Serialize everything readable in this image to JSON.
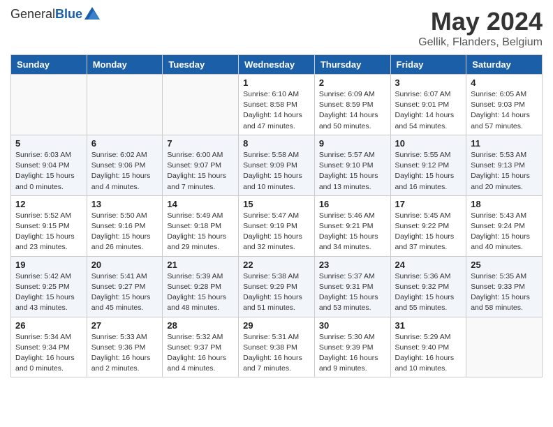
{
  "header": {
    "logo_general": "General",
    "logo_blue": "Blue",
    "title": "May 2024",
    "subtitle": "Gellik, Flanders, Belgium"
  },
  "weekdays": [
    "Sunday",
    "Monday",
    "Tuesday",
    "Wednesday",
    "Thursday",
    "Friday",
    "Saturday"
  ],
  "weeks": [
    [
      {
        "day": "",
        "info": ""
      },
      {
        "day": "",
        "info": ""
      },
      {
        "day": "",
        "info": ""
      },
      {
        "day": "1",
        "info": "Sunrise: 6:10 AM\nSunset: 8:58 PM\nDaylight: 14 hours\nand 47 minutes."
      },
      {
        "day": "2",
        "info": "Sunrise: 6:09 AM\nSunset: 8:59 PM\nDaylight: 14 hours\nand 50 minutes."
      },
      {
        "day": "3",
        "info": "Sunrise: 6:07 AM\nSunset: 9:01 PM\nDaylight: 14 hours\nand 54 minutes."
      },
      {
        "day": "4",
        "info": "Sunrise: 6:05 AM\nSunset: 9:03 PM\nDaylight: 14 hours\nand 57 minutes."
      }
    ],
    [
      {
        "day": "5",
        "info": "Sunrise: 6:03 AM\nSunset: 9:04 PM\nDaylight: 15 hours\nand 0 minutes."
      },
      {
        "day": "6",
        "info": "Sunrise: 6:02 AM\nSunset: 9:06 PM\nDaylight: 15 hours\nand 4 minutes."
      },
      {
        "day": "7",
        "info": "Sunrise: 6:00 AM\nSunset: 9:07 PM\nDaylight: 15 hours\nand 7 minutes."
      },
      {
        "day": "8",
        "info": "Sunrise: 5:58 AM\nSunset: 9:09 PM\nDaylight: 15 hours\nand 10 minutes."
      },
      {
        "day": "9",
        "info": "Sunrise: 5:57 AM\nSunset: 9:10 PM\nDaylight: 15 hours\nand 13 minutes."
      },
      {
        "day": "10",
        "info": "Sunrise: 5:55 AM\nSunset: 9:12 PM\nDaylight: 15 hours\nand 16 minutes."
      },
      {
        "day": "11",
        "info": "Sunrise: 5:53 AM\nSunset: 9:13 PM\nDaylight: 15 hours\nand 20 minutes."
      }
    ],
    [
      {
        "day": "12",
        "info": "Sunrise: 5:52 AM\nSunset: 9:15 PM\nDaylight: 15 hours\nand 23 minutes."
      },
      {
        "day": "13",
        "info": "Sunrise: 5:50 AM\nSunset: 9:16 PM\nDaylight: 15 hours\nand 26 minutes."
      },
      {
        "day": "14",
        "info": "Sunrise: 5:49 AM\nSunset: 9:18 PM\nDaylight: 15 hours\nand 29 minutes."
      },
      {
        "day": "15",
        "info": "Sunrise: 5:47 AM\nSunset: 9:19 PM\nDaylight: 15 hours\nand 32 minutes."
      },
      {
        "day": "16",
        "info": "Sunrise: 5:46 AM\nSunset: 9:21 PM\nDaylight: 15 hours\nand 34 minutes."
      },
      {
        "day": "17",
        "info": "Sunrise: 5:45 AM\nSunset: 9:22 PM\nDaylight: 15 hours\nand 37 minutes."
      },
      {
        "day": "18",
        "info": "Sunrise: 5:43 AM\nSunset: 9:24 PM\nDaylight: 15 hours\nand 40 minutes."
      }
    ],
    [
      {
        "day": "19",
        "info": "Sunrise: 5:42 AM\nSunset: 9:25 PM\nDaylight: 15 hours\nand 43 minutes."
      },
      {
        "day": "20",
        "info": "Sunrise: 5:41 AM\nSunset: 9:27 PM\nDaylight: 15 hours\nand 45 minutes."
      },
      {
        "day": "21",
        "info": "Sunrise: 5:39 AM\nSunset: 9:28 PM\nDaylight: 15 hours\nand 48 minutes."
      },
      {
        "day": "22",
        "info": "Sunrise: 5:38 AM\nSunset: 9:29 PM\nDaylight: 15 hours\nand 51 minutes."
      },
      {
        "day": "23",
        "info": "Sunrise: 5:37 AM\nSunset: 9:31 PM\nDaylight: 15 hours\nand 53 minutes."
      },
      {
        "day": "24",
        "info": "Sunrise: 5:36 AM\nSunset: 9:32 PM\nDaylight: 15 hours\nand 55 minutes."
      },
      {
        "day": "25",
        "info": "Sunrise: 5:35 AM\nSunset: 9:33 PM\nDaylight: 15 hours\nand 58 minutes."
      }
    ],
    [
      {
        "day": "26",
        "info": "Sunrise: 5:34 AM\nSunset: 9:34 PM\nDaylight: 16 hours\nand 0 minutes."
      },
      {
        "day": "27",
        "info": "Sunrise: 5:33 AM\nSunset: 9:36 PM\nDaylight: 16 hours\nand 2 minutes."
      },
      {
        "day": "28",
        "info": "Sunrise: 5:32 AM\nSunset: 9:37 PM\nDaylight: 16 hours\nand 4 minutes."
      },
      {
        "day": "29",
        "info": "Sunrise: 5:31 AM\nSunset: 9:38 PM\nDaylight: 16 hours\nand 7 minutes."
      },
      {
        "day": "30",
        "info": "Sunrise: 5:30 AM\nSunset: 9:39 PM\nDaylight: 16 hours\nand 9 minutes."
      },
      {
        "day": "31",
        "info": "Sunrise: 5:29 AM\nSunset: 9:40 PM\nDaylight: 16 hours\nand 10 minutes."
      },
      {
        "day": "",
        "info": ""
      }
    ]
  ]
}
